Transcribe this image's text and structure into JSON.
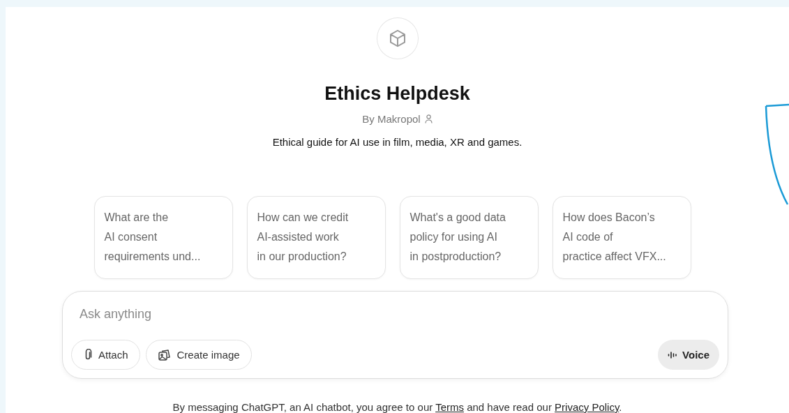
{
  "gpt": {
    "name": "Ethics Helpdesk",
    "author": "By Makropol",
    "description": "Ethical guide for AI use in film, media, XR and games."
  },
  "suggestions": [
    {
      "lines": [
        "What are the",
        "AI consent",
        "requirements und..."
      ]
    },
    {
      "lines": [
        "How can we credit",
        "AI-assisted work",
        "in our production?"
      ]
    },
    {
      "lines": [
        "What's a good data",
        "policy for using AI",
        "in postproduction?"
      ]
    },
    {
      "lines": [
        "How does Bacon’s",
        "AI code of",
        "practice affect VFX..."
      ]
    }
  ],
  "composer": {
    "placeholder": "Ask anything",
    "buttons": [
      {
        "kind": "attach",
        "label": "Attach"
      },
      {
        "kind": "image",
        "label": "Create image"
      }
    ],
    "voice": {
      "label": "Voice"
    }
  },
  "footer": {
    "before": "By messaging ChatGPT, an AI chatbot, you agree to our ",
    "terms": "Terms",
    "middle": " and have read our ",
    "privacy": "Privacy Policy",
    "after": "."
  }
}
